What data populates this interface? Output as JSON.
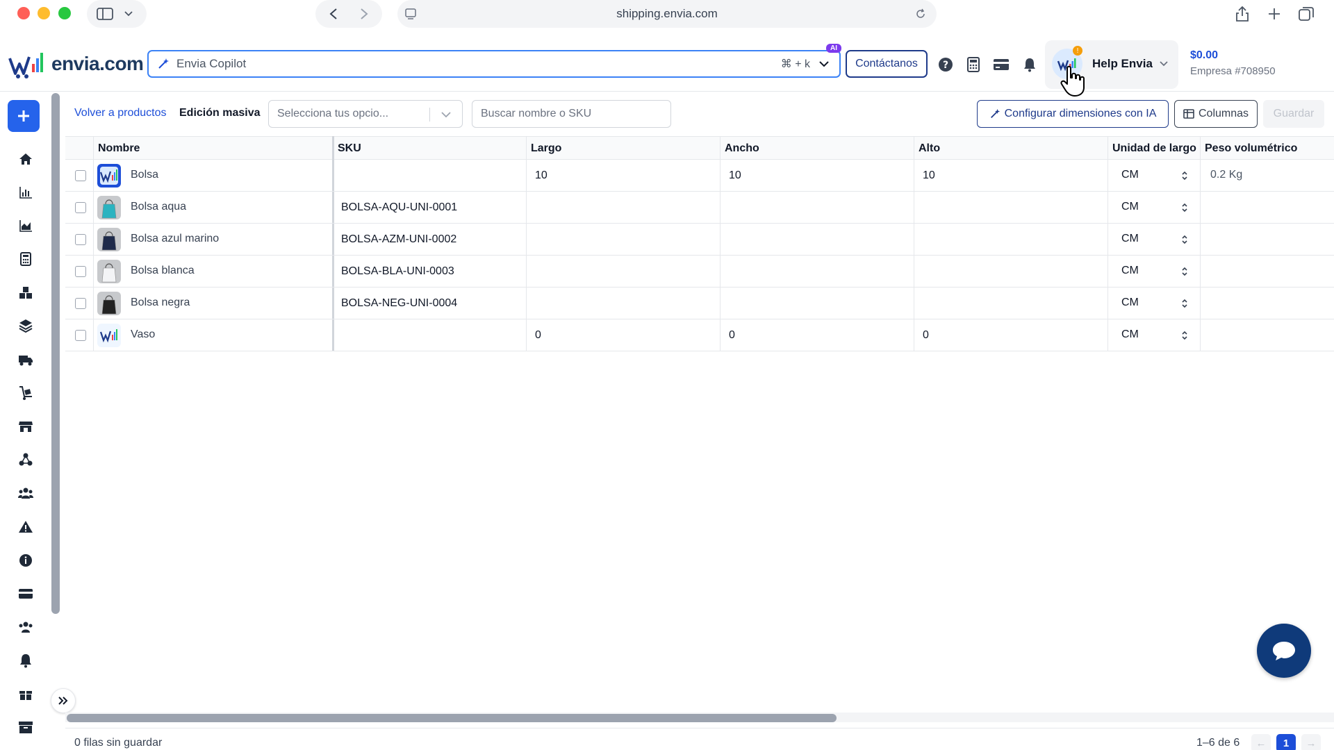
{
  "browser": {
    "url": "shipping.envia.com"
  },
  "header": {
    "logo_text": "envia.com",
    "copilot_placeholder": "Envia Copilot",
    "copilot_shortcut": "⌘ + k",
    "ai_badge": "AI",
    "contact_label": "Contáctanos",
    "account_name": "Help Envia",
    "notification_count": "!",
    "balance": "$0.00",
    "company": "Empresa #708950"
  },
  "toolbar": {
    "back_label": "Volver a productos",
    "mass_edit_label": "Edición masiva",
    "select_placeholder": "Selecciona tus opcio...",
    "search_placeholder": "Buscar nombre o SKU",
    "ai_dimensions_label": "Configurar dimensiones con IA",
    "columns_label": "Columnas",
    "save_label": "Guardar"
  },
  "table": {
    "columns": [
      "Nombre",
      "SKU",
      "Largo",
      "Ancho",
      "Alto",
      "Unidad de largo",
      "Peso volumétrico"
    ],
    "rows": [
      {
        "name": "Bolsa",
        "sku": "",
        "largo": "10",
        "ancho": "10",
        "alto": "10",
        "unit": "CM",
        "peso": "0.2 Kg",
        "thumb": "logo"
      },
      {
        "name": "Bolsa aqua",
        "sku": "BOLSA-AQU-UNI-0001",
        "largo": "",
        "ancho": "",
        "alto": "",
        "unit": "CM",
        "peso": "",
        "thumb": "aqua"
      },
      {
        "name": "Bolsa azul marino",
        "sku": "BOLSA-AZM-UNI-0002",
        "largo": "",
        "ancho": "",
        "alto": "",
        "unit": "CM",
        "peso": "",
        "thumb": "navy"
      },
      {
        "name": "Bolsa blanca",
        "sku": "BOLSA-BLA-UNI-0003",
        "largo": "",
        "ancho": "",
        "alto": "",
        "unit": "CM",
        "peso": "",
        "thumb": "white"
      },
      {
        "name": "Bolsa negra",
        "sku": "BOLSA-NEG-UNI-0004",
        "largo": "",
        "ancho": "",
        "alto": "",
        "unit": "CM",
        "peso": "",
        "thumb": "black"
      },
      {
        "name": "Vaso",
        "sku": "",
        "largo": "0",
        "ancho": "0",
        "alto": "0",
        "unit": "CM",
        "peso": "",
        "thumb": "logo-light"
      }
    ]
  },
  "footer": {
    "unsaved_label": "0 filas sin guardar",
    "range_label": "1–6 de 6",
    "current_page": "1",
    "prev_arrow": "←",
    "next_arrow": "→"
  },
  "colors": {
    "primary": "#2563eb",
    "navy": "#1e3a8a",
    "chat": "#0f3a7a",
    "warning": "#f59e0b",
    "ai": "#7c3aed"
  },
  "icons": {
    "sidebar": [
      "home-icon",
      "bar-chart-icon",
      "area-chart-icon",
      "calculator-icon",
      "boxes-icon",
      "layers-icon",
      "truck-icon",
      "dolly-icon",
      "store-icon",
      "network-icon",
      "users-icon",
      "warning-icon",
      "info-icon",
      "card-icon",
      "team-icon",
      "bell-icon",
      "gift-icon",
      "archive-icon"
    ]
  }
}
